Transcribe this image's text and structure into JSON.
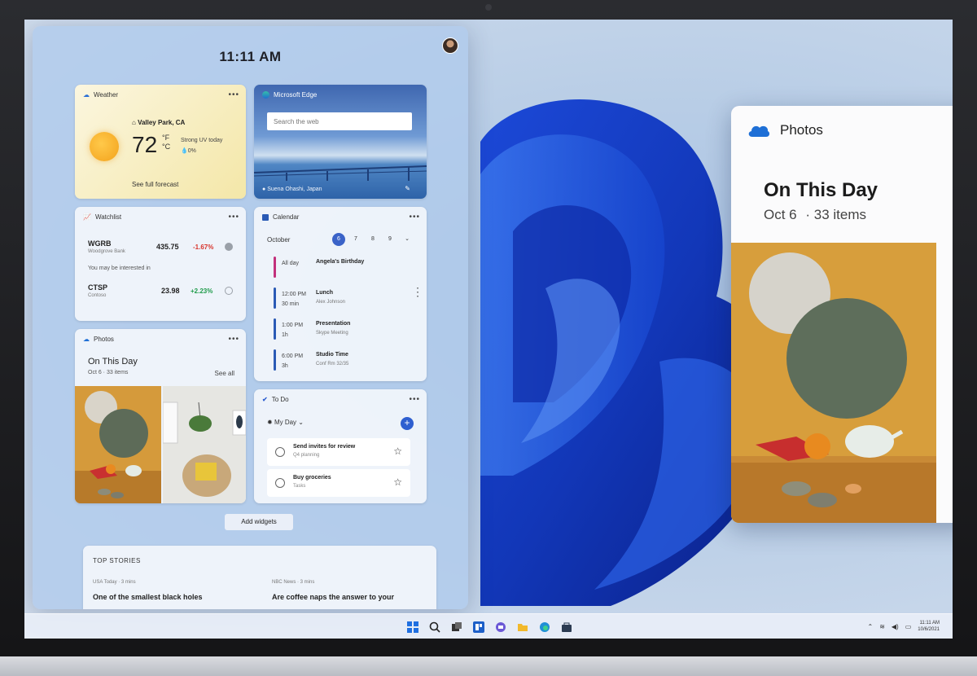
{
  "board": {
    "time": "11:11 AM",
    "add_widgets_label": "Add widgets"
  },
  "weather": {
    "title": "Weather",
    "location": "Valley Park, CA",
    "temp": "72",
    "unit_f": "°F",
    "unit_c": "°C",
    "condition": "Strong UV today",
    "precip": "0%",
    "forecast_link": "See full forecast"
  },
  "edge": {
    "title": "Microsoft Edge",
    "search_placeholder": "Search the web",
    "caption": "Suena Ohashi, Japan"
  },
  "watchlist": {
    "title": "Watchlist",
    "stocks": [
      {
        "symbol": "WGRB",
        "name": "Woodgrove Bank",
        "price": "435.75",
        "change": "-1.67%"
      },
      {
        "symbol": "CTSP",
        "name": "Contoso",
        "price": "23.98",
        "change": "+2.23%"
      }
    ],
    "interested_label": "You may be interested in",
    "colors": {
      "down": "#d8342c",
      "up": "#1f9b4a"
    }
  },
  "calendar": {
    "title": "Calendar",
    "month": "October",
    "days": [
      "6",
      "7",
      "8",
      "9"
    ],
    "events": [
      {
        "time": "All day",
        "title": "Angela's Birthday",
        "sub": "",
        "color": "#c2307c"
      },
      {
        "time": "12:00 PM",
        "duration": "30 min",
        "title": "Lunch",
        "sub": "Alex Johnson",
        "color": "#2a5ab5"
      },
      {
        "time": "1:00 PM",
        "duration": "1h",
        "title": "Presentation",
        "sub": "Skype Meeting",
        "color": "#2a5ab5"
      },
      {
        "time": "6:00 PM",
        "duration": "3h",
        "title": "Studio Time",
        "sub": "Conf Rm 32/35",
        "color": "#2a5ab5"
      }
    ]
  },
  "photos_widget": {
    "title": "Photos",
    "heading": "On This Day",
    "sub": "Oct 6 · 33 items",
    "see_all": "See all"
  },
  "todo": {
    "title": "To Do",
    "list": "My Day",
    "tasks": [
      {
        "title": "Send invites for review",
        "sub": "Q4 planning"
      },
      {
        "title": "Buy groceries",
        "sub": "Tasks"
      }
    ]
  },
  "stories": {
    "title": "TOP STORIES",
    "items": [
      {
        "source": "USA Today · 3 mins",
        "headline": "One of the smallest black holes"
      },
      {
        "source": "NBC News · 3 mins",
        "headline": "Are coffee naps the answer to your"
      }
    ]
  },
  "photos_app": {
    "app_name": "Photos",
    "heading": "On This Day",
    "date": "Oct 6",
    "count": "· 33 items"
  },
  "taskbar": {
    "icons": [
      "windows-start-icon",
      "search-icon",
      "task-view-icon",
      "widgets-icon",
      "chat-icon",
      "file-explorer-icon",
      "edge-icon",
      "store-icon"
    ],
    "clock_time": "11:11 AM",
    "clock_date": "10/6/2021"
  }
}
